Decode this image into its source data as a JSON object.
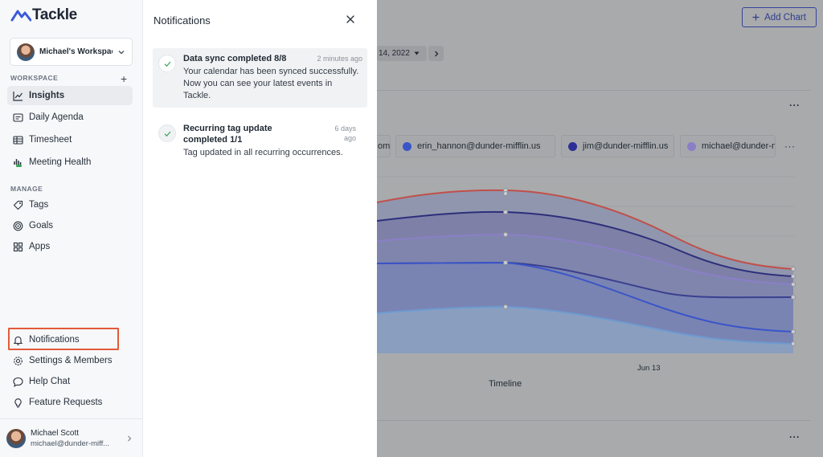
{
  "app": {
    "name": "Tackle"
  },
  "sidebar": {
    "workspace_name": "Michael's Workspace",
    "workspace_section": "WORKSPACE",
    "workspace_items": [
      {
        "label": "Insights",
        "icon": "chart-line-icon",
        "active": true
      },
      {
        "label": "Daily Agenda",
        "icon": "agenda-icon"
      },
      {
        "label": "Timesheet",
        "icon": "table-icon"
      },
      {
        "label": "Meeting Health",
        "icon": "bar-chart-icon"
      }
    ],
    "manage_section": "MANAGE",
    "manage_items": [
      {
        "label": "Tags",
        "icon": "tag-icon"
      },
      {
        "label": "Goals",
        "icon": "target-icon"
      },
      {
        "label": "Apps",
        "icon": "grid-icon"
      }
    ],
    "bottom_items": [
      {
        "label": "Notifications",
        "icon": "bell-icon"
      },
      {
        "label": "Settings & Members",
        "icon": "gear-icon"
      },
      {
        "label": "Help Chat",
        "icon": "chat-icon"
      },
      {
        "label": "Feature Requests",
        "icon": "lightbulb-icon"
      }
    ],
    "user": {
      "name": "Michael Scott",
      "email": "michael@dunder-miff..."
    }
  },
  "notifications": {
    "title": "Notifications",
    "items": [
      {
        "title": "Data sync completed 8/8",
        "time": "2 minutes ago",
        "body": "Your calendar has been synced successfully. Now you can see your latest events in Tackle."
      },
      {
        "title": "Recurring tag update completed 1/1",
        "time": "6 days ago",
        "body": "Tag updated in all recurring occurrences."
      }
    ]
  },
  "dashboard": {
    "add_chart_label": "Add Chart",
    "date_label": "14, 2022",
    "more_label": "···",
    "legend": [
      {
        "label": "om",
        "color": "#c7c7c9"
      },
      {
        "label": "erin_hannon@dunder-mifflin.us",
        "color": "#3a55c8"
      },
      {
        "label": "jim@dunder-mifflin.us",
        "color": "#2c2f96"
      },
      {
        "label": "michael@dunder-m",
        "color": "#8a7fc7"
      }
    ],
    "x_tick": "Jun 13",
    "x_axis_label": "Timeline"
  },
  "colors": {
    "accent": "#2e3d8f",
    "highlight_box": "#e25b3a",
    "success_check": "#3aa657"
  }
}
